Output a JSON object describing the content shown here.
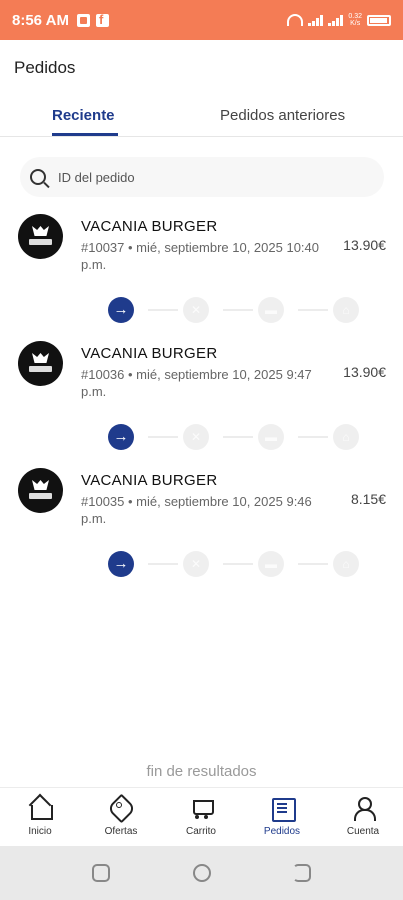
{
  "status_bar": {
    "time": "8:56 AM",
    "net_speed_top": "0.32",
    "net_speed_bottom": "K/s",
    "icons": [
      "message-icon",
      "facebook-icon",
      "wifi-icon",
      "signal-icon",
      "battery-icon"
    ]
  },
  "header": {
    "title": "Pedidos"
  },
  "tabs": [
    {
      "label": "Reciente",
      "active": true
    },
    {
      "label": "Pedidos anteriores",
      "active": false
    }
  ],
  "search": {
    "placeholder": "ID del pedido",
    "value": ""
  },
  "orders": [
    {
      "name": "VACANIA BURGER",
      "meta": "#10037 • mié, septiembre 10, 2025 10:40 p.m.",
      "price": "13.90€",
      "step": 1
    },
    {
      "name": "VACANIA BURGER",
      "meta": "#10036 • mié, septiembre 10, 2025 9:47 p.m.",
      "price": "13.90€",
      "step": 1
    },
    {
      "name": "VACANIA BURGER",
      "meta": "#10035 • mié, septiembre 10, 2025 9:46 p.m.",
      "price": "8.15€",
      "step": 1
    }
  ],
  "tracking_steps": [
    "arrow-right-icon",
    "cancel-icon",
    "bag-icon",
    "home-icon"
  ],
  "end_text": "fin de resultados",
  "bottom_nav": [
    {
      "label": "Inicio",
      "icon": "home-icon",
      "active": false
    },
    {
      "label": "Ofertas",
      "icon": "tag-icon",
      "active": false
    },
    {
      "label": "Carrito",
      "icon": "cart-icon",
      "active": false
    },
    {
      "label": "Pedidos",
      "icon": "orders-icon",
      "active": true
    },
    {
      "label": "Cuenta",
      "icon": "user-icon",
      "active": false
    }
  ],
  "colors": {
    "status_bar": "#f47c55",
    "accent": "#1f3b8c"
  }
}
